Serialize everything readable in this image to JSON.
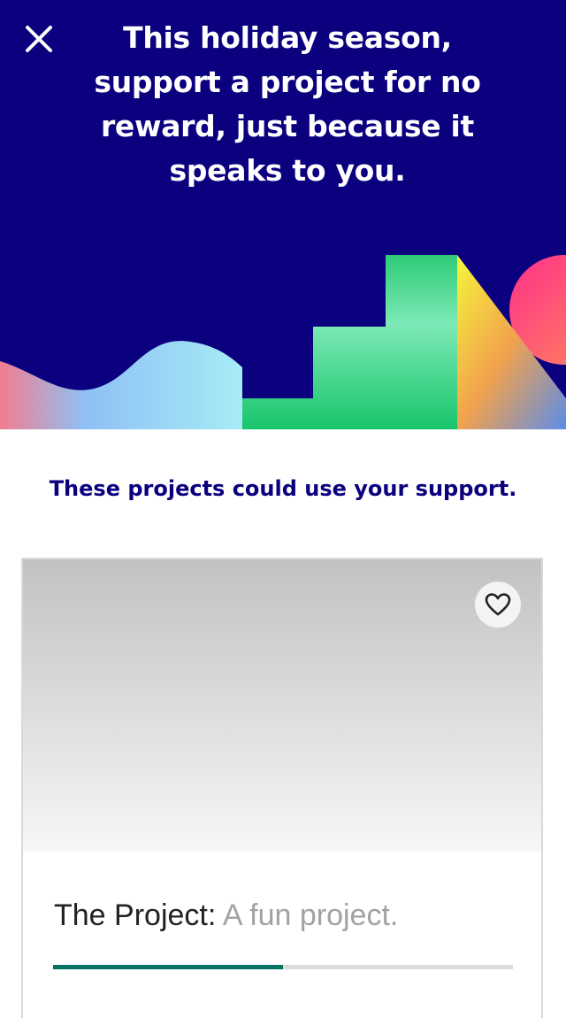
{
  "hero": {
    "title": "This holiday season, support a project for no reward, just because it speaks to you.",
    "close_icon": "close-icon",
    "background_color": "#0b007e"
  },
  "subtitle": "These projects could use your support.",
  "project_card": {
    "name": "The Project:",
    "blurb": "A fun project.",
    "favorite_icon": "heart-outline-icon",
    "progress_fraction": 0.5,
    "progress_color": "#037362"
  }
}
